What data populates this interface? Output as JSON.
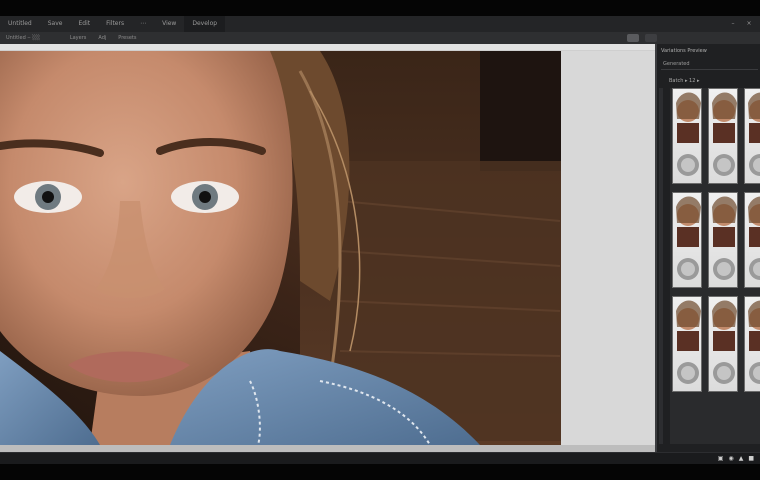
{
  "menubar": {
    "items": [
      "Untitled",
      "Save",
      "Edit",
      "Filters",
      "⋯",
      "View",
      "Develop"
    ],
    "active_index": 6,
    "window_controls": [
      "–",
      "×"
    ]
  },
  "optionsbar": {
    "items": [
      "Untitled ‒ ░░",
      "Layers",
      "Adj",
      "Presets"
    ]
  },
  "panel": {
    "tab_label": "Variations Preview",
    "sub_label": "Generated",
    "thumbs_header": "Batch ▸ 12 ▸"
  },
  "status": {
    "icons": [
      "▣",
      "◉",
      "▲",
      "■"
    ]
  },
  "colors": {
    "chrome": "#242527",
    "panel": "#1f2022",
    "canvas": "#cfcfcf",
    "denim": "#6f8fb0"
  },
  "icons": {
    "window_min": "minimize-icon",
    "window_close": "close-icon"
  }
}
